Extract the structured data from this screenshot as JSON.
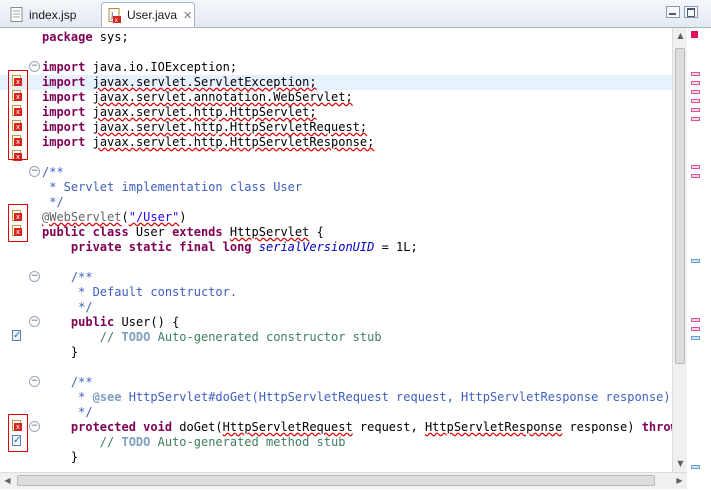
{
  "tabs": [
    {
      "label": "index.jsp",
      "active": false
    },
    {
      "label": "User.java",
      "active": true,
      "close_glyph": "✕",
      "icon": "java-file-error-icon"
    }
  ],
  "code": {
    "package": "package",
    "package_rest": " sys;",
    "import_kw": "import",
    "imports": [
      "java.io.IOException;",
      "javax.servlet.ServletException;",
      "javax.servlet.annotation.WebServlet;",
      "javax.servlet.http.HttpServlet;",
      "javax.servlet.http.HttpServletRequest;",
      "javax.servlet.http.HttpServletResponse;"
    ],
    "doc_open": "/**",
    "class_doc": " * Servlet implementation class User",
    "doc_close": " */",
    "annotation": "@WebServlet",
    "annotation_paren_open": "(",
    "annotation_value": "\"/User\"",
    "annotation_paren_close": ")",
    "class_kw": "public class",
    "class_name": " User ",
    "extends_kw": "extends",
    "superclass": "HttpServlet",
    "class_brace": " {",
    "field_kw": "private static final long",
    "field_name": "serialVersionUID",
    "field_rest": " = 1L;",
    "ctor_doc": " * Default constructor.",
    "ctor_kw": "public",
    "ctor_sig": " User() {",
    "todo_prefix": "// ",
    "todo_tag": "TODO",
    "ctor_todo": " Auto-generated constructor stub",
    "brace_close": "}",
    "see_prefix": " * ",
    "see_tag": "@see",
    "see_text": " HttpServlet#doGet(HttpServletRequest request, HttpServletResponse response)",
    "method_kw": "protected void",
    "method_name": " doGet(",
    "method_param1": "HttpServletRequest",
    "method_mid": " request, ",
    "method_param2": "HttpServletResponse",
    "method_mid2": " response) ",
    "throws_kw": "throws",
    "method_todo": " Auto-generated method stub"
  },
  "markers": {
    "error_icon": "error-x-icon",
    "task_icon": "task-checkbox-icon",
    "fold_glyph": "−"
  },
  "colors": {
    "keyword": "#7f0055",
    "comment": "#3f7f5f",
    "javadoc": "#3f5fbf",
    "string": "#2a00ff",
    "error": "#e00000",
    "highlight": "#e8f2fe"
  }
}
